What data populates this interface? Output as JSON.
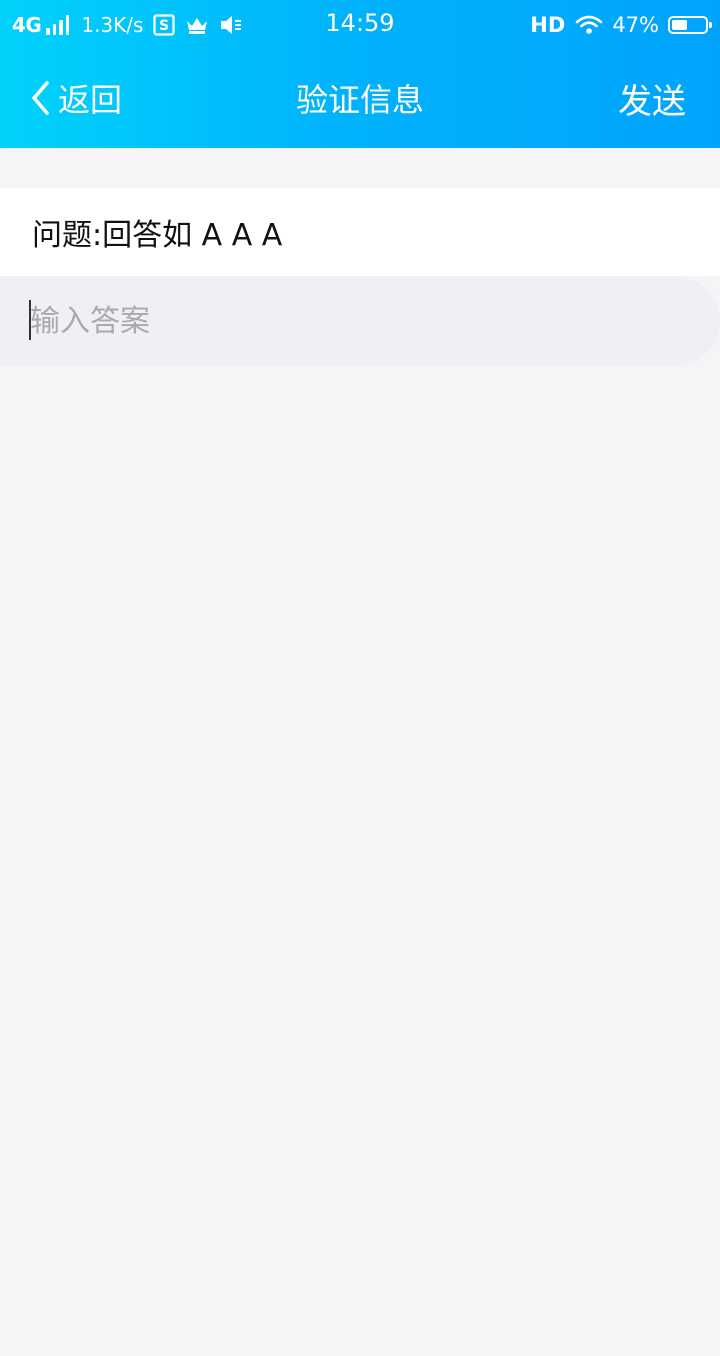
{
  "status_bar": {
    "network": "4G",
    "speed": "1.3K/s",
    "time": "14:59",
    "hd": "HD",
    "battery_percent": "47%",
    "battery_level": 0.47,
    "icons": [
      "signal-icon",
      "s-app-icon",
      "crown-icon",
      "mute-icon",
      "wifi-icon",
      "battery-icon"
    ]
  },
  "nav": {
    "back_label": "返回",
    "title": "验证信息",
    "send_label": "发送"
  },
  "question": {
    "text": "问题:回答如 A A A"
  },
  "answer": {
    "placeholder": "输入答案",
    "value": ""
  },
  "colors": {
    "header_gradient_start": "#00d2fb",
    "header_gradient_end": "#00a4fd",
    "background": "#f5f5f8",
    "input_background": "#f0f0f4"
  }
}
